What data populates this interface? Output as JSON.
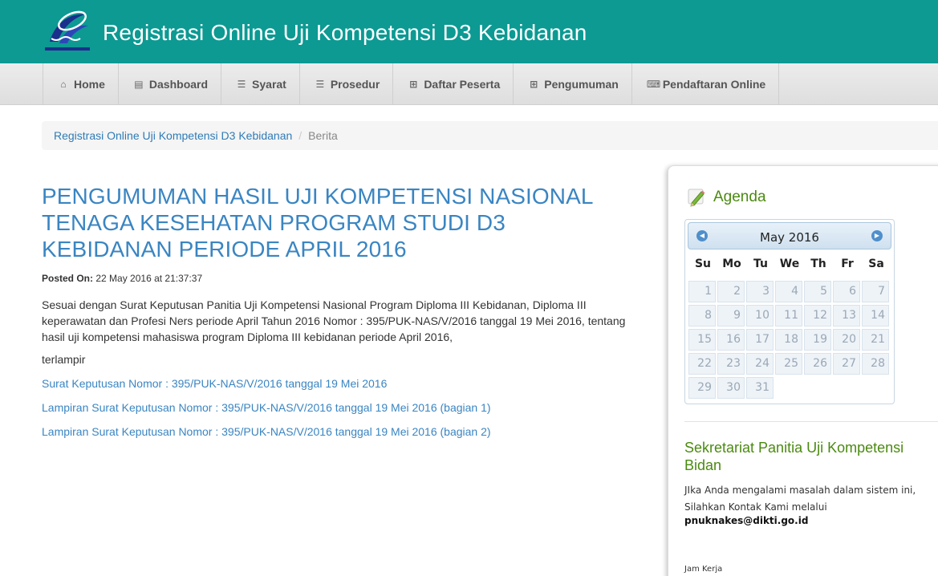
{
  "header": {
    "site_title": "Registrasi Online Uji Kompetensi D3 Kebidanan",
    "logo_icon": "dikti-logo",
    "bg_color": "#0c9a93"
  },
  "nav": {
    "items": [
      {
        "label": "Home",
        "icon": "home-icon",
        "glyph": "⌂"
      },
      {
        "label": "Dashboard",
        "icon": "book-icon",
        "glyph": "▤"
      },
      {
        "label": "Syarat",
        "icon": "list-icon",
        "glyph": "☰"
      },
      {
        "label": "Prosedur",
        "icon": "list-icon",
        "glyph": "☰"
      },
      {
        "label": "Daftar Peserta",
        "icon": "table-icon",
        "glyph": "⊞"
      },
      {
        "label": "Pengumuman",
        "icon": "table-icon",
        "glyph": "⊞"
      },
      {
        "label": "Pendaftaran Online",
        "icon": "keyboard-icon",
        "glyph": "⌨"
      }
    ]
  },
  "breadcrumb": {
    "home": "Registrasi Online Uji Kompetensi D3 Kebidanan",
    "separator": "/",
    "current": "Berita"
  },
  "article": {
    "title": "PENGUMUMAN HASIL UJI KOMPETENSI NASIONAL TENAGA KESEHATAN PROGRAM STUDI D3 KEBIDANAN PERIODE APRIL 2016",
    "posted_label": "Posted On:",
    "posted_value": "22 May 2016 at 21:37:37",
    "body": "Sesuai dengan Surat Keputusan Panitia Uji Kompetensi Nasional Program Diploma III Kebidanan, Diploma III keperawatan dan Profesi Ners periode April Tahun 2016 Nomor : 395/PUK-NAS/V/2016 tanggal 19 Mei 2016, tentang hasil uji kompetensi mahasiswa program Diploma III kebidanan periode April 2016,",
    "terlampir": "terlampir",
    "links": [
      "Surat Keputusan Nomor : 395/PUK-NAS/V/2016 tanggal 19 Mei 2016",
      "Lampiran Surat Keputusan Nomor : 395/PUK-NAS/V/2016 tanggal 19 Mei 2016 (bagian 1)",
      "Lampiran Surat Keputusan Nomor : 395/PUK-NAS/V/2016 tanggal 19 Mei 2016 (bagian 2)"
    ]
  },
  "sidebar": {
    "agenda_title": "Agenda",
    "calendar": {
      "month_label": "May 2016",
      "prev_icon": "◀",
      "next_icon": "▶",
      "days_of_week": [
        "Su",
        "Mo",
        "Tu",
        "We",
        "Th",
        "Fr",
        "Sa"
      ],
      "days": [
        "1",
        "2",
        "3",
        "4",
        "5",
        "6",
        "7",
        "8",
        "9",
        "10",
        "11",
        "12",
        "13",
        "14",
        "15",
        "16",
        "17",
        "18",
        "19",
        "20",
        "21",
        "22",
        "23",
        "24",
        "25",
        "26",
        "27",
        "28",
        "29",
        "30",
        "31"
      ]
    },
    "secretariat_title": "Sekretariat Panitia Uji Kompetensi Bidan",
    "secretariat_line1": "JIka Anda mengalami masalah dalam sistem ini,",
    "secretariat_line2": "Silahkan Kontak Kami melalui",
    "email": "pnuknakes@dikti.go.id",
    "jam_kerja": "Jam Kerja"
  }
}
